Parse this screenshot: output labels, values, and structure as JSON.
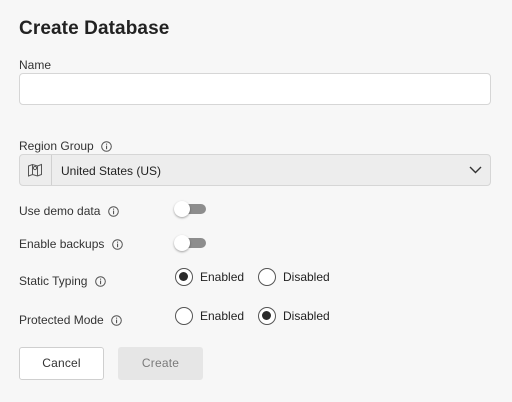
{
  "dialog": {
    "title": "Create Database"
  },
  "name_field": {
    "label": "Name",
    "value": "",
    "placeholder": ""
  },
  "region_group": {
    "label": "Region Group",
    "selected": "United States (US)",
    "icon": "map-icon"
  },
  "use_demo_data": {
    "label": "Use demo data",
    "on": false
  },
  "enable_backups": {
    "label": "Enable backups",
    "on": false
  },
  "static_typing": {
    "label": "Static Typing",
    "options": [
      "Enabled",
      "Disabled"
    ],
    "selected": "Enabled"
  },
  "protected_mode": {
    "label": "Protected Mode",
    "options": [
      "Enabled",
      "Disabled"
    ],
    "selected": "Disabled"
  },
  "buttons": {
    "cancel": "Cancel",
    "create": "Create"
  },
  "colors": {
    "background": "#f7f7f7",
    "toggle_off_track": "#8d8d8d",
    "create_disabled_bg": "#e6e6e6"
  }
}
